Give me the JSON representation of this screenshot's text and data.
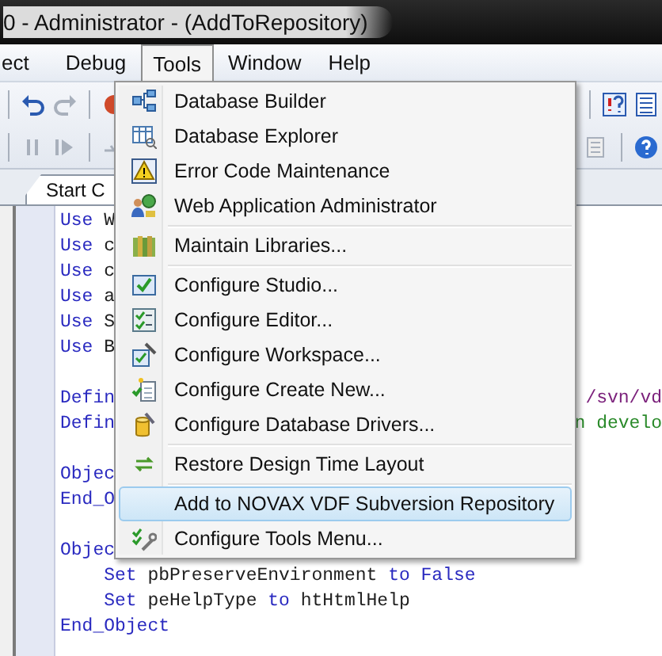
{
  "window": {
    "title": "0 - Administrator - (AddToRepository)"
  },
  "menu_bar": [
    {
      "label": "ect",
      "open": false
    },
    {
      "label": "Debug",
      "open": false
    },
    {
      "label": "Tools",
      "open": true
    },
    {
      "label": "Window",
      "open": false
    },
    {
      "label": "Help",
      "open": false
    }
  ],
  "tab": {
    "label": "Start C"
  },
  "tools_menu": {
    "items": [
      {
        "kind": "item",
        "label": "Database Builder",
        "selected": false
      },
      {
        "kind": "item",
        "label": "Database Explorer",
        "selected": false
      },
      {
        "kind": "item",
        "label": "Error Code Maintenance",
        "selected": false
      },
      {
        "kind": "item",
        "label": "Web Application Administrator",
        "selected": false
      },
      {
        "kind": "separator"
      },
      {
        "kind": "item",
        "label": "Maintain Libraries...",
        "selected": false
      },
      {
        "kind": "separator"
      },
      {
        "kind": "item",
        "label": "Configure Studio...",
        "selected": false
      },
      {
        "kind": "item",
        "label": "Configure Editor...",
        "selected": false
      },
      {
        "kind": "item",
        "label": "Configure Workspace...",
        "selected": false
      },
      {
        "kind": "item",
        "label": "Configure Create New...",
        "selected": false
      },
      {
        "kind": "item",
        "label": "Configure Database Drivers...",
        "selected": false
      },
      {
        "kind": "separator"
      },
      {
        "kind": "item",
        "label": "Restore Design Time Layout",
        "selected": false
      },
      {
        "kind": "separator"
      },
      {
        "kind": "item",
        "label": "Add to NOVAX VDF Subversion Repository",
        "selected": true
      },
      {
        "kind": "item",
        "label": "Configure Tools Menu...",
        "selected": false
      }
    ]
  },
  "editor": {
    "lines": [
      {
        "kind": "code",
        "left": [
          {
            "text": "Use",
            "kind": "keyword"
          },
          {
            "text": "W",
            "kind": "plain"
          }
        ]
      },
      {
        "kind": "code",
        "left": [
          {
            "text": "Use",
            "kind": "keyword"
          },
          {
            "text": "c",
            "kind": "plain"
          }
        ]
      },
      {
        "kind": "code",
        "left": [
          {
            "text": "Use",
            "kind": "keyword"
          },
          {
            "text": "c",
            "kind": "plain"
          }
        ]
      },
      {
        "kind": "code",
        "left": [
          {
            "text": "Use",
            "kind": "keyword"
          },
          {
            "text": "a",
            "kind": "plain"
          }
        ]
      },
      {
        "kind": "code",
        "left": [
          {
            "text": "Use",
            "kind": "keyword"
          },
          {
            "text": "S",
            "kind": "plain"
          }
        ]
      },
      {
        "kind": "code",
        "left": [
          {
            "text": "Use",
            "kind": "keyword"
          },
          {
            "text": "B",
            "kind": "plain"
          }
        ]
      },
      {
        "kind": "blank"
      },
      {
        "kind": "code",
        "left": [
          {
            "text": "Defin",
            "kind": "keyword"
          }
        ],
        "right": [
          {
            "text": "/svn/vd",
            "kind": "string"
          }
        ]
      },
      {
        "kind": "code",
        "left": [
          {
            "text": "Defin",
            "kind": "keyword"
          }
        ],
        "right": [
          {
            "text": "n develo",
            "kind": "comment"
          }
        ]
      },
      {
        "kind": "blank"
      },
      {
        "kind": "code",
        "left": [
          {
            "text": "Objec",
            "kind": "keyword"
          }
        ]
      },
      {
        "kind": "code",
        "left": [
          {
            "text": "End_O",
            "kind": "keyword"
          }
        ]
      },
      {
        "kind": "blank"
      },
      {
        "kind": "code",
        "left": [
          {
            "text": "Objec",
            "kind": "keyword"
          }
        ]
      },
      {
        "kind": "code",
        "left": [
          {
            "text": "    Set",
            "kind": "keyword"
          },
          {
            "text": "pbPreserveEnvironment",
            "kind": "plain"
          },
          {
            "text": "to",
            "kind": "keyword"
          },
          {
            "text": "False",
            "kind": "keyword"
          }
        ]
      },
      {
        "kind": "code",
        "left": [
          {
            "text": "    Set",
            "kind": "keyword"
          },
          {
            "text": "peHelpType",
            "kind": "plain"
          },
          {
            "text": "to",
            "kind": "keyword"
          },
          {
            "text": "htHtmlHelp",
            "kind": "plain"
          }
        ]
      },
      {
        "kind": "code",
        "left": [
          {
            "text": "End_Object",
            "kind": "keyword"
          }
        ]
      }
    ]
  }
}
